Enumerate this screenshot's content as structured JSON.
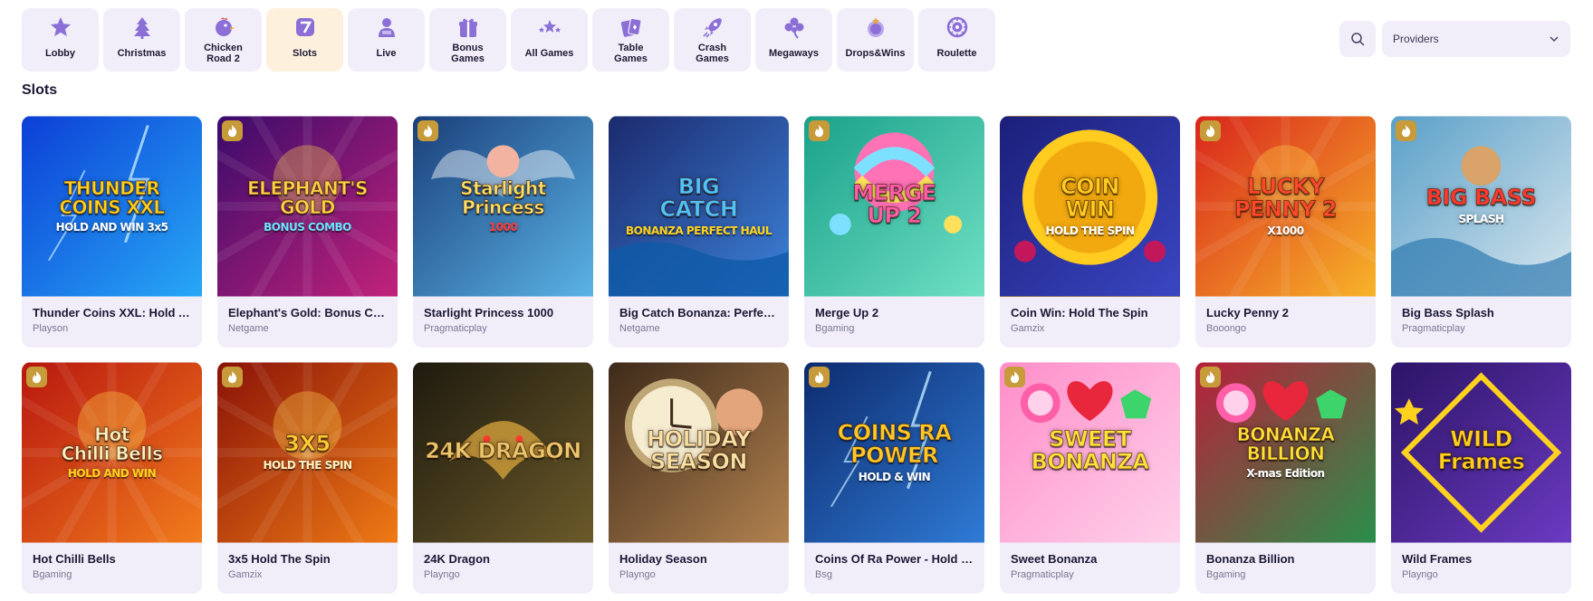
{
  "nav": {
    "categories": [
      {
        "label": "Lobby",
        "icon": "star-icon"
      },
      {
        "label": "Christmas",
        "icon": "christmas-tree-icon"
      },
      {
        "label": "Chicken\nRoad 2",
        "icon": "chicken-icon"
      },
      {
        "label": "Slots",
        "icon": "seven-slot-icon",
        "active": true
      },
      {
        "label": "Live",
        "icon": "live-dealer-icon"
      },
      {
        "label": "Bonus\nGames",
        "icon": "gift-icon"
      },
      {
        "label": "All Games",
        "icon": "stars-icon"
      },
      {
        "label": "Table\nGames",
        "icon": "cards-icon"
      },
      {
        "label": "Crash\nGames",
        "icon": "rocket-icon"
      },
      {
        "label": "Megaways",
        "icon": "clover-icon"
      },
      {
        "label": "Drops&Wins",
        "icon": "drops-wins-icon"
      },
      {
        "label": "Roulette",
        "icon": "roulette-icon"
      }
    ],
    "active_color": "#fdf1dd",
    "icon_color": "#8b6fd6"
  },
  "providers": {
    "label": "Providers"
  },
  "section": {
    "title": "Slots"
  },
  "games": [
    {
      "name": "Thunder Coins XXL: Hold And Win",
      "provider": "Playson",
      "art": "THUNDER\nCOINS XXL",
      "sub": "HOLD AND WIN 3x5",
      "hot": false
    },
    {
      "name": "Elephant's Gold: Bonus Combo",
      "provider": "Netgame",
      "art": "ELEPHANT'S\nGOLD",
      "sub": "BONUS COMBO",
      "hot": true
    },
    {
      "name": "Starlight Princess 1000",
      "provider": "Pragmaticplay",
      "art": "Starlight\nPrincess",
      "sub": "1000",
      "hot": true
    },
    {
      "name": "Big Catch Bonanza: Perfect Haul",
      "provider": "Netgame",
      "art": "BIG\nCATCH",
      "sub": "BONANZA PERFECT HAUL",
      "hot": false
    },
    {
      "name": "Merge Up 2",
      "provider": "Bgaming",
      "art": "MERGE\nUP 2",
      "sub": "",
      "hot": true
    },
    {
      "name": "Coin Win: Hold The Spin",
      "provider": "Gamzix",
      "art": "COIN\nWIN",
      "sub": "HOLD THE SPIN",
      "hot": false
    },
    {
      "name": "Lucky Penny 2",
      "provider": "Booongo",
      "art": "LUCKY\nPENNY 2",
      "sub": "X1000",
      "hot": true
    },
    {
      "name": "Big Bass Splash",
      "provider": "Pragmaticplay",
      "art": "BIG BASS",
      "sub": "SPLASH",
      "hot": true
    },
    {
      "name": "Hot Chilli Bells",
      "provider": "Bgaming",
      "art": "Hot\nChilli Bells",
      "sub": "HOLD AND WIN",
      "hot": true
    },
    {
      "name": "3x5 Hold The Spin",
      "provider": "Gamzix",
      "art": "3X5",
      "sub": "HOLD THE SPIN",
      "hot": true
    },
    {
      "name": "24K Dragon",
      "provider": "Playngo",
      "art": "24K DRAGON",
      "sub": "",
      "hot": false
    },
    {
      "name": "Holiday Season",
      "provider": "Playngo",
      "art": "HOLIDAY\nSEASON",
      "sub": "",
      "hot": false
    },
    {
      "name": "Coins Of Ra Power - Hold & Win",
      "provider": "Bsg",
      "art": "COINS RA\nPOWER",
      "sub": "HOLD & WIN",
      "hot": true
    },
    {
      "name": "Sweet Bonanza",
      "provider": "Pragmaticplay",
      "art": "SWEET\nBONANZA",
      "sub": "",
      "hot": true
    },
    {
      "name": "Bonanza Billion",
      "provider": "Bgaming",
      "art": "BONANZA\nBILLION",
      "sub": "X-mas Edition",
      "hot": true
    },
    {
      "name": "Wild Frames",
      "provider": "Playngo",
      "art": "WILD\nFrames",
      "sub": "",
      "hot": false
    }
  ]
}
